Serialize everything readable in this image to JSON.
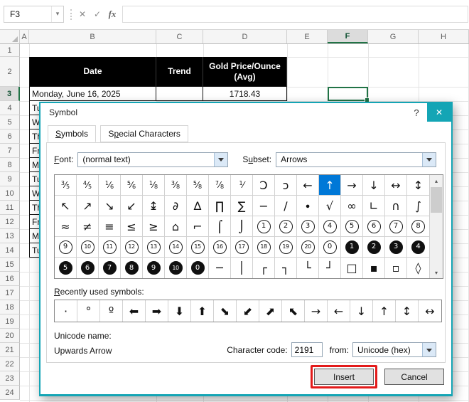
{
  "excel": {
    "name_box": "F3",
    "formula_bar": "",
    "formula_buttons": {
      "cancel": "✕",
      "enter": "✓",
      "fx": "fx"
    },
    "columns": [
      "A",
      "B",
      "C",
      "D",
      "E",
      "F",
      "G",
      "H"
    ],
    "selected_column": "F",
    "rows": [
      "1",
      "2",
      "3",
      "4",
      "5",
      "6",
      "7",
      "8",
      "9",
      "10",
      "11",
      "12",
      "13",
      "14",
      "15",
      "16",
      "17",
      "18",
      "19",
      "20",
      "21",
      "22",
      "23",
      "24"
    ],
    "selected_row": "3",
    "table": {
      "header": {
        "date": "Date",
        "trend": "Trend",
        "price": "Gold Price/Ounce (Avg)"
      },
      "first_row": {
        "date": "Monday, June 16, 2025",
        "price": "1718.43"
      },
      "partial_rows": [
        "Tu",
        "W",
        "Th",
        "Fr",
        "M",
        "Tu",
        "W",
        "Th",
        "Fr",
        "M",
        "Tu"
      ]
    }
  },
  "dialog": {
    "title": "Symbol",
    "help_icon": "?",
    "close_icon": "✕",
    "tabs": [
      {
        "text": "Symbols",
        "u": 0
      },
      {
        "text": "Special Characters",
        "u": 1
      }
    ],
    "font_label": {
      "text": "Font:",
      "u": 0
    },
    "font_value": "(normal text)",
    "subset_label": {
      "text": "Subset:",
      "u": 1
    },
    "subset_value": "Arrows",
    "symbol_grid": {
      "rows": [
        [
          "⅗",
          "⅘",
          "⅙",
          "⅚",
          "⅛",
          "⅜",
          "⅝",
          "⅞",
          "⅟",
          "Ɔ",
          "ɔ",
          "←",
          "↑",
          "→",
          "↓",
          "↔",
          "↕"
        ],
        [
          "↖",
          "↗",
          "↘",
          "↙",
          "↨",
          "∂",
          "∆",
          "∏",
          "∑",
          "−",
          "∕",
          "∙",
          "√",
          "∞",
          "∟",
          "∩",
          "∫"
        ],
        [
          "≈",
          "≠",
          "≡",
          "≤",
          "≥",
          "⌂",
          "⌐",
          "⌠",
          "⌡",
          "①",
          "②",
          "③",
          "④",
          "⑤",
          "⑥",
          "⑦",
          "⑧"
        ],
        [
          "⑨",
          "⑩",
          "⑪",
          "⑫",
          "⑬",
          "⑭",
          "⑮",
          "⑯",
          "⑰",
          "⑱",
          "⑲",
          "⑳",
          "⓪",
          "❶",
          "❷",
          "❸",
          "❹"
        ],
        [
          "❺",
          "❻",
          "❼",
          "❽",
          "❾",
          "❿",
          "⓿",
          "─",
          "│",
          "┌",
          "┐",
          "└",
          "┘",
          "□",
          "▪",
          "▫",
          "◊"
        ]
      ],
      "selected": {
        "row": 0,
        "col": 12,
        "symbol": "↑"
      }
    },
    "scrollbar": {
      "up": "▴",
      "down": "▾"
    },
    "recent_label": {
      "text": "Recently used symbols:",
      "u": 0
    },
    "recent_symbols": [
      "·",
      "°",
      "º",
      "⬅",
      "➡",
      "⬇",
      "⬆",
      "⬊",
      "⬋",
      "⬈",
      "⬉",
      "→",
      "←",
      "↓",
      "↑",
      "↕",
      "↔"
    ],
    "unicode_name_label": "Unicode name:",
    "unicode_name_value": "Upwards Arrow",
    "character_code_label": "Character code:",
    "character_code_value": "2191",
    "from_label": "from:",
    "from_value": "Unicode (hex)",
    "insert_label": "Insert",
    "cancel_label": "Cancel",
    "colors": {
      "accent_teal": "#14a5b5",
      "selection_blue": "#0078d7",
      "annotation_red": "#e31b1b",
      "excel_green": "#217346",
      "table_header_bg": "#000000"
    }
  }
}
